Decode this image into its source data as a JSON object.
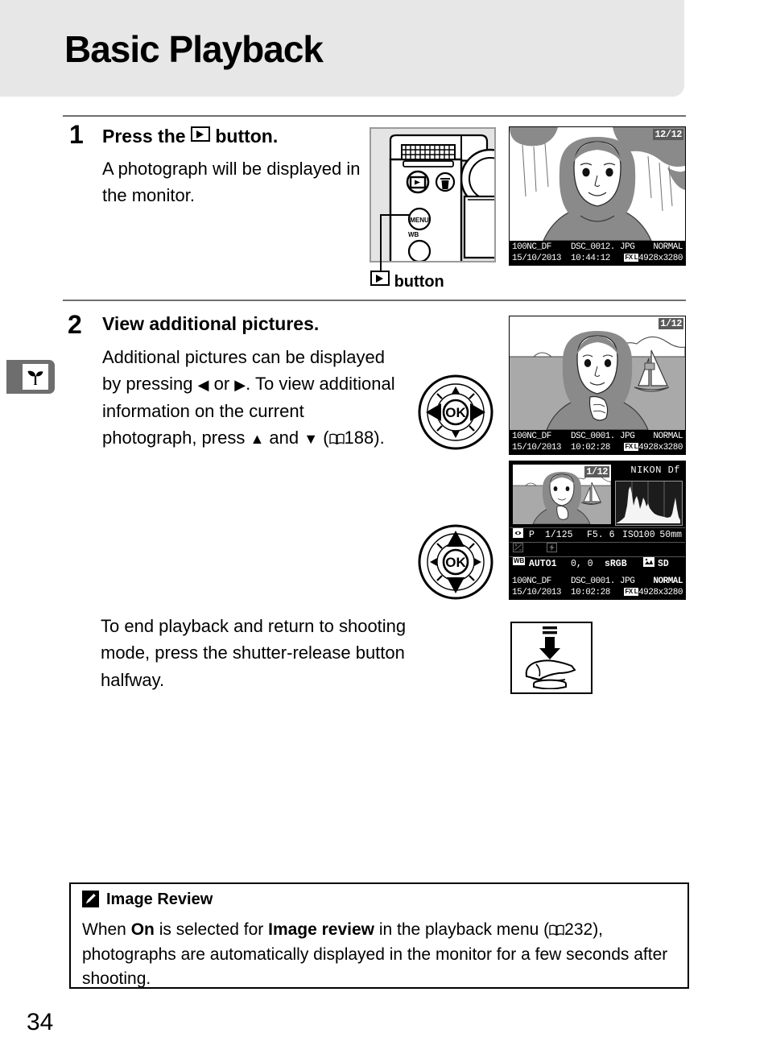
{
  "header": {
    "title": "Basic Playback"
  },
  "side_tab": {
    "icon": "sprout-icon"
  },
  "steps": [
    {
      "number": "1",
      "heading_before": "Press the",
      "heading_icon": "playback-icon",
      "heading_after": "button.",
      "body": "A photograph will be displayed in the monitor."
    },
    {
      "number": "2",
      "heading": "View additional pictures.",
      "body_part1": "Additional pictures can be displayed by pressing",
      "arrow_left": "◀",
      "body_part2": "or",
      "arrow_right": "▶",
      "body_part3": ". To view additional information on the current photograph, press",
      "arrow_up": "▲",
      "body_part4": "and",
      "arrow_down": "▼",
      "body_part5": "(",
      "page_ref": "188",
      "body_part6": ").",
      "end_text": "To end playback and return to shooting mode, press the shutter-release button halfway."
    }
  ],
  "camera_figure": {
    "caption_icon": "playback-icon",
    "caption_text": "button",
    "menu_label": "MENU",
    "wb_label": "WB"
  },
  "dials": [
    {
      "label": "OK",
      "emphasis": "left-right"
    },
    {
      "label": "OK",
      "emphasis": "up-down"
    }
  ],
  "lcds": [
    {
      "name": "lcd-playback-full",
      "frame_counter": "12/12",
      "folder": "100NC_DF",
      "filename": "DSC_0012. JPG",
      "quality": "NORMAL",
      "date": "15/10/2013",
      "time": "10:44:12",
      "area_badge": "FX",
      "size_badge": "L",
      "dimensions": "4928x3280"
    },
    {
      "name": "lcd-playback-first",
      "frame_counter": "1/12",
      "folder": "100NC_DF",
      "filename": "DSC_0001. JPG",
      "quality": "NORMAL",
      "date": "15/10/2013",
      "time": "10:02:28",
      "area_badge": "FX",
      "size_badge": "L",
      "dimensions": "4928x3280"
    },
    {
      "name": "lcd-shooting-info",
      "frame_counter": "1/12",
      "model": "NIKON  Df",
      "shooting": {
        "metering_icon": "matrix-metering-icon",
        "mode": "P",
        "shutter": "1/125",
        "aperture": "F5. 6",
        "iso_badge": "ISO",
        "iso_value": "100",
        "focal": "50mm"
      },
      "compensation": {
        "exp_comp_icon": "exposure-compensation-icon",
        "flash_comp_icon": "flash-compensation-icon"
      },
      "color": {
        "wb_badge": "WB",
        "wb_value": "AUTO1",
        "wb_fine": "0,  0",
        "colorspace": "sRGB",
        "picture_icon": "picture-control-icon",
        "picture_control": "SD"
      },
      "folder": "100NC_DF",
      "filename": "DSC_0001. JPG",
      "quality": "NORMAL",
      "date": "15/10/2013",
      "time": "10:02:28",
      "area_badge": "FX",
      "size_badge": "L",
      "dimensions": "4928x3280"
    }
  ],
  "hand_figure": {
    "icon": "press-shutter-halfway-icon"
  },
  "note": {
    "icon": "pencil-icon",
    "title": "Image Review",
    "part1": "When ",
    "bold1": "On",
    "part2": " is selected for ",
    "bold2": "Image review",
    "part3": " in the playback menu (",
    "page_ref": "232",
    "part4": "), photographs are automatically displayed in the monitor for a few seconds after shooting."
  },
  "page_number": "34",
  "colors": {
    "header_band": "#e7e7e7",
    "rule": "#6f6f6f",
    "side_tab": "#6e6e6e",
    "lcd_bg": "#000000"
  }
}
